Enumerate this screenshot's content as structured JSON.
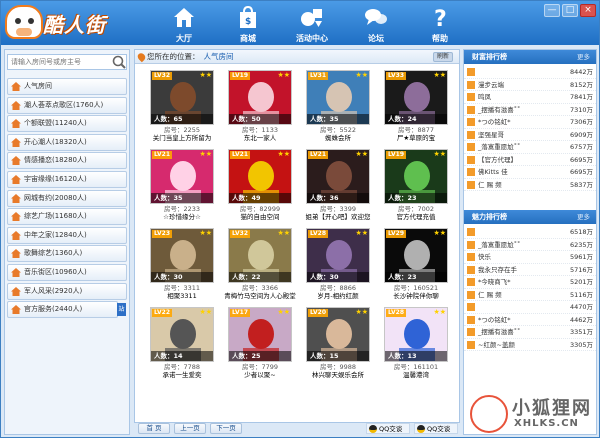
{
  "app": {
    "logo_text": "酷人街"
  },
  "nav": [
    {
      "label": "大厅",
      "icon": "home-icon"
    },
    {
      "label": "商城",
      "icon": "shopping-bag-icon"
    },
    {
      "label": "活动中心",
      "icon": "activity-center-icon"
    },
    {
      "label": "论坛",
      "icon": "forum-chat-icon"
    },
    {
      "label": "帮助",
      "icon": "help-question-icon"
    }
  ],
  "window": {
    "min": "—",
    "max": "□",
    "close": "×"
  },
  "search": {
    "placeholder": "请输入房间号或房主号"
  },
  "categories": [
    {
      "label": "人气房间"
    },
    {
      "label": "潮人荟萃点歌区(1760人)"
    },
    {
      "label": "个额联盟(11240人)"
    },
    {
      "label": "开心潮人(18320人)"
    },
    {
      "label": "情感播恋(18280人)"
    },
    {
      "label": "宇宙缘缘(16120人)"
    },
    {
      "label": "网城有约(20080人)"
    },
    {
      "label": "综艺广场(11680人)"
    },
    {
      "label": "中年之家(12840人)"
    },
    {
      "label": "歌舞综艺(1360人)"
    },
    {
      "label": "音乐街区(10960人)"
    },
    {
      "label": "军人风采(2920人)"
    },
    {
      "label": "官方服务(2440人)",
      "tag": "站"
    }
  ],
  "center": {
    "crumb_prefix": "您所在的位置：",
    "crumb_room": "人气房间",
    "refresh": "刷新"
  },
  "rooms": [
    {
      "level": "LV32",
      "people": "人数：65",
      "id": "房号：2255",
      "name": "关门当皇上方所留为"
    },
    {
      "level": "LV19",
      "people": "人数：50",
      "id": "房号：1133",
      "name": "东北一家人"
    },
    {
      "level": "LV31",
      "people": "人数：35",
      "id": "房号：5522",
      "name": "蜘蛛会所"
    },
    {
      "level": "LV33",
      "people": "人数：24",
      "id": "房号：8877",
      "name": "尸★草原的宝"
    },
    {
      "level": "LV21",
      "people": "人数：35",
      "id": "房号：2233",
      "name": "☆珍惜缘分☆"
    },
    {
      "level": "LV21",
      "people": "人数：49",
      "id": "房号：82999",
      "name": "猫的自由空间"
    },
    {
      "level": "LV21",
      "people": "人数：36",
      "id": "房号：3399",
      "name": "姐弟【开心吧】欢迎您"
    },
    {
      "level": "LV19",
      "people": "人数：23",
      "id": "房号：7002",
      "name": "官方代理充值"
    },
    {
      "level": "LV23",
      "people": "人数：30",
      "id": "房号：3311",
      "name": "相聚3311"
    },
    {
      "level": "LV32",
      "people": "人数：22",
      "id": "房号：3366",
      "name": "青梅竹马空间为人心殿堂"
    },
    {
      "level": "LV28",
      "people": "人数：30",
      "id": "房号：8866",
      "name": "岁月-相约红颜"
    },
    {
      "level": "LV29",
      "people": "人数：23",
      "id": "房号：160521",
      "name": "长沙钟院伴你聊"
    },
    {
      "level": "LV22",
      "people": "人数：14",
      "id": "房号：7788",
      "name": "承诺一生爱奕"
    },
    {
      "level": "LV17",
      "people": "人数：25",
      "id": "房号：7799",
      "name": "少者以聚~"
    },
    {
      "level": "LV20",
      "people": "人数：15",
      "id": "房号：9988",
      "name": "林兴聊天娱乐会所"
    },
    {
      "level": "LV28",
      "people": "人数：13",
      "id": "房号：161101",
      "name": "温馨港湾"
    }
  ],
  "pager": {
    "first": "首 页",
    "prev": "上一页",
    "next": "下一页",
    "qq1": "QQ交谈",
    "qq2": "QQ交谈"
  },
  "rank1": {
    "title": "财富排行榜",
    "more": "更多",
    "items": [
      {
        "name": "",
        "value": "8442万"
      },
      {
        "name": "漫步云端",
        "value": "8152万"
      },
      {
        "name": "鸣凤",
        "value": "7841万"
      },
      {
        "name": "_摆播有滋喜˚˚",
        "value": "7310万"
      },
      {
        "name": "*つの铭虹*",
        "value": "7306万"
      },
      {
        "name": "坚强星哥",
        "value": "6909万"
      },
      {
        "name": "_落寞重愿尬˚˚",
        "value": "6757万"
      },
      {
        "name": "【官方代理】",
        "value": "6695万"
      },
      {
        "name": "佛Kitts 佳",
        "value": "6695万"
      },
      {
        "name": "仁 赐 频",
        "value": "5837万"
      }
    ]
  },
  "rank2": {
    "title": "魅力排行榜",
    "more": "更多",
    "items": [
      {
        "name": "",
        "value": "6518万"
      },
      {
        "name": "_落寞重愿尬˚˚",
        "value": "6235万"
      },
      {
        "name": "快乐",
        "value": "5961万"
      },
      {
        "name": "我永只存在手",
        "value": "5716万"
      },
      {
        "name": "*今晓商飞*",
        "value": "5201万"
      },
      {
        "name": "仁 赐 频",
        "value": "5116万"
      },
      {
        "name": "",
        "value": "4470万"
      },
      {
        "name": "*つの铭虹*",
        "value": "4462万"
      },
      {
        "name": "_摆播有滋喜˚˚",
        "value": "3351万"
      },
      {
        "name": "~红颜~盖颜",
        "value": "3305万"
      }
    ]
  },
  "watermark": {
    "cn": "小狐狸网",
    "en": "XHLKS.CN"
  }
}
